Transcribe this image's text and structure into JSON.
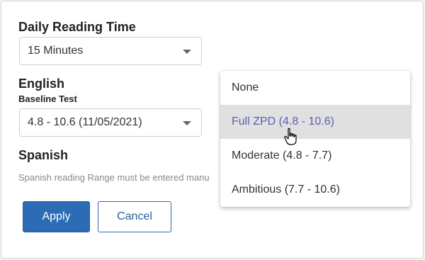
{
  "daily_reading": {
    "title": "Daily Reading Time",
    "selected": "15 Minutes"
  },
  "english": {
    "title": "English",
    "sublabel": "Baseline Test",
    "selected": "4.8 - 10.6 (11/05/2021)"
  },
  "spanish": {
    "title": "Spanish",
    "note": "Spanish reading Range must be entered manu"
  },
  "buttons": {
    "apply": "Apply",
    "cancel": "Cancel"
  },
  "dropdown": {
    "options": [
      {
        "label": "None"
      },
      {
        "label": "Full ZPD (4.8 - 10.6)",
        "highlighted": true
      },
      {
        "label": "Moderate (4.8 - 7.7)"
      },
      {
        "label": "Ambitious (7.7 - 10.6)"
      }
    ]
  },
  "colors": {
    "primary": "#2b6cb5",
    "highlight_bg": "#e0e0e0",
    "highlight_text": "#5b5fb3"
  },
  "icons": {
    "caret": "chevron-down-icon",
    "cursor": "hand-pointer-icon"
  }
}
